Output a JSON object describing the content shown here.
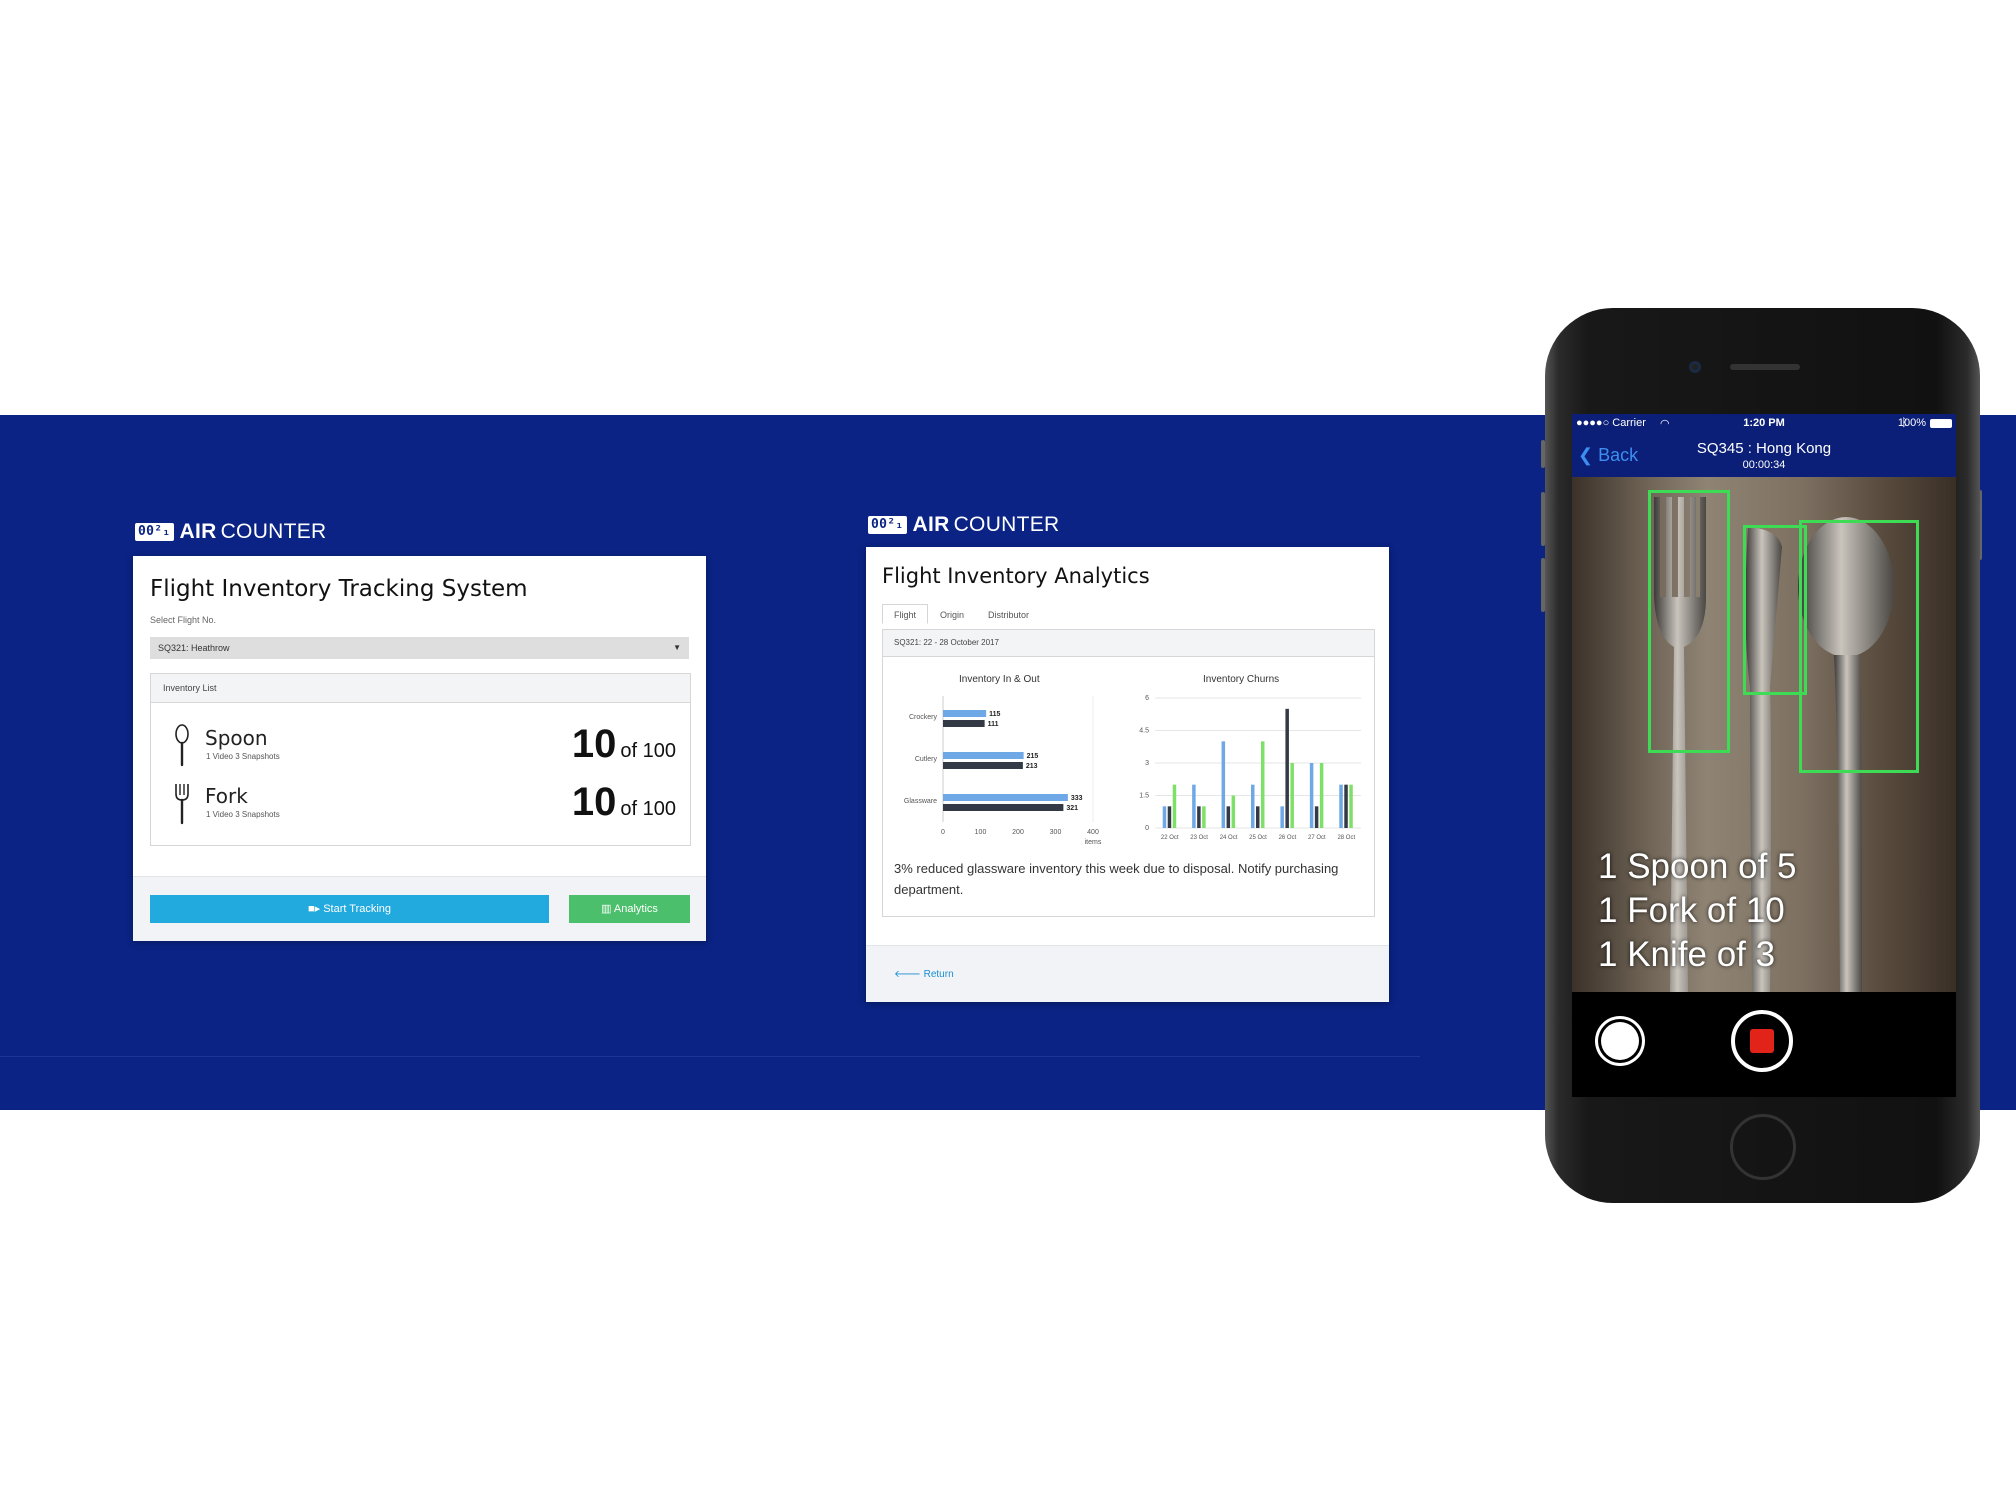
{
  "logo": {
    "mark": "00²₁",
    "air": "AIR",
    "counter": "COUNTER"
  },
  "tracking": {
    "title": "Flight Inventory Tracking System",
    "select_label": "Select Flight No.",
    "selected_flight": "SQ321: Heathrow",
    "inventory_header": "Inventory List",
    "items": [
      {
        "name": "Spoon",
        "detail": "1 Video 3 Snapshots",
        "count": "10",
        "total": "of 100",
        "icon": "spoon-icon"
      },
      {
        "name": "Fork",
        "detail": "1 Video 3 Snapshots",
        "count": "10",
        "total": "of 100",
        "icon": "fork-icon"
      }
    ],
    "start_button": "Start Tracking",
    "analytics_button": "Analytics"
  },
  "analytics": {
    "title": "Flight Inventory Analytics",
    "tabs": [
      "Flight",
      "Origin",
      "Distributor"
    ],
    "period": "SQ321: 22 - 28 October 2017",
    "note": "3% reduced glassware inventory this week due to disposal. Notify purchasing department.",
    "return_label": "Return"
  },
  "chart_data": [
    {
      "type": "bar",
      "orientation": "horizontal",
      "title": "Inventory In & Out",
      "categories": [
        "Crockery",
        "Cutlery",
        "Glassware"
      ],
      "series": [
        {
          "values": [
            115,
            215,
            333
          ],
          "color": "#6fa8e6"
        },
        {
          "values": [
            111,
            213,
            321
          ],
          "color": "#333a45"
        }
      ],
      "xlabel": "items",
      "xticks": [
        "0",
        "100",
        "200",
        "300",
        "400"
      ],
      "xlim": [
        0,
        400
      ]
    },
    {
      "type": "bar",
      "title": "Inventory Churns",
      "categories": [
        "22 Oct",
        "23 Oct",
        "24 Oct",
        "25 Oct",
        "26 Oct",
        "27 Oct",
        "28 Oct"
      ],
      "series": [
        {
          "values": [
            1.0,
            2.0,
            4.0,
            2.0,
            1.0,
            3.0,
            2.0
          ],
          "color": "#6fa8e6"
        },
        {
          "values": [
            1.0,
            1.0,
            1.0,
            1.0,
            5.5,
            1.0,
            2.0
          ],
          "color": "#333a45"
        },
        {
          "values": [
            2.0,
            1.0,
            1.5,
            4.0,
            3.0,
            3.0,
            2.0
          ],
          "color": "#7ee069"
        }
      ],
      "yticks": [
        "0",
        "1.5",
        "3",
        "4.5",
        "6"
      ],
      "ylim": [
        0,
        6
      ],
      "grid": true
    }
  ],
  "phone": {
    "status": {
      "carrier": "●●●●○ Carrier",
      "time": "1:20 PM",
      "battery": "100%"
    },
    "back_label": "Back",
    "title": "SQ345 : Hong Kong",
    "timer": "00:00:34",
    "overlay": [
      "1 Spoon of 5",
      "1 Fork of 10",
      "1 Knife of 3"
    ],
    "detection_color": "#3edc54"
  },
  "colors": {
    "band": "#0a2384",
    "primary": "#22a9dd",
    "success": "#4bbf6b",
    "record": "#e2231a"
  }
}
